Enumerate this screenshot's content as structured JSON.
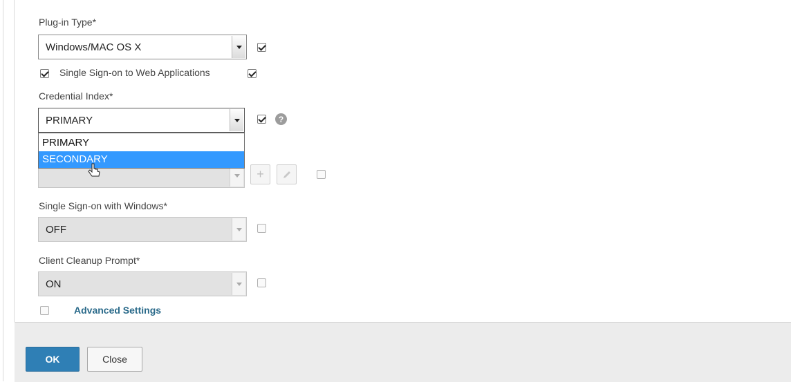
{
  "form": {
    "plugin_type": {
      "label": "Plug-in Type*",
      "value": "Windows/MAC OS X"
    },
    "sso_web": {
      "label": "Single Sign-on to Web Applications",
      "checked": true
    },
    "credential_index": {
      "label": "Credential Index*",
      "value": "PRIMARY",
      "options": [
        "PRIMARY",
        "SECONDARY"
      ],
      "highlighted": "SECONDARY",
      "help_icon": "?"
    },
    "hidden_field": {
      "add_label": "+",
      "edit_icon": "pencil-icon"
    },
    "sso_windows": {
      "label": "Single Sign-on with Windows*",
      "value": "OFF"
    },
    "client_cleanup": {
      "label": "Client Cleanup Prompt*",
      "value": "ON"
    },
    "advanced": {
      "label": "Advanced Settings"
    }
  },
  "footer": {
    "ok_label": "OK",
    "close_label": "Close"
  },
  "colors": {
    "primary": "#2f7fb5",
    "highlight": "#3399ff",
    "link": "#2a6a8a"
  }
}
